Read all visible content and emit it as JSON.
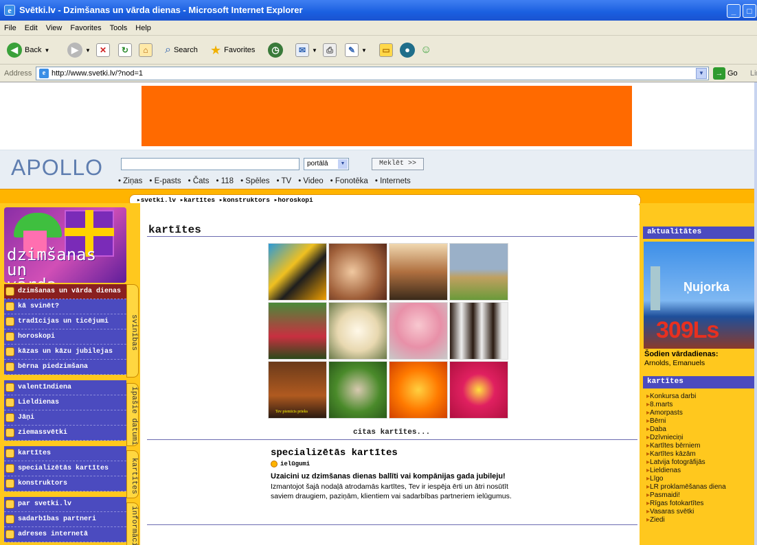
{
  "window": {
    "title": "Svētki.lv - Dzimšanas un vārda dienas - Microsoft Internet Explorer"
  },
  "menubar": [
    "File",
    "Edit",
    "View",
    "Favorites",
    "Tools",
    "Help"
  ],
  "toolbar": {
    "back": "Back",
    "search": "Search",
    "favorites": "Favorites"
  },
  "address": {
    "label": "Address",
    "url": "http://www.svetki.lv/?nod=1",
    "go": "Go",
    "links": "Lin"
  },
  "portal": {
    "logo": "APOLLO",
    "select": "portālā",
    "button": "Meklēt >>",
    "nav": [
      "Ziņas",
      "E-pasts",
      "Čats",
      "118",
      "Spēles",
      "TV",
      "Video",
      "Fonotēka",
      "Internets"
    ]
  },
  "breadcrumb": [
    "svetki.lv",
    "kartītes",
    "konstruktors",
    "horoskopi"
  ],
  "promo": {
    "line1": "dzimšanas un",
    "line2": "vārda dienas"
  },
  "sidemenu": {
    "group1": {
      "tab": "svinības",
      "items": [
        "dzimšanas un vārda dienas",
        "kā svinēt?",
        "tradīcijas un ticējumi",
        "horoskopi",
        "kāzas un kāzu jubilejas",
        "bērna piedzimšana"
      ]
    },
    "group2": {
      "tab": "īpašie datumi",
      "items": [
        "valentīndiena",
        "Lieldienas",
        "Jāņi",
        "ziemassvētki"
      ]
    },
    "group3": {
      "tab": "kartītes",
      "items": [
        "kartītes",
        "specializētās kartītes",
        "konstruktors"
      ]
    },
    "group4": {
      "tab": "informācija",
      "items": [
        "par svetki.lv",
        "sadarbības partneri",
        "adreses internetā"
      ]
    }
  },
  "main": {
    "heading": "kartītes",
    "more": "citas kartītes...",
    "special": {
      "title": "specializētās kartītes",
      "tag": "ielūgumi",
      "bold": "Uzaicini uz dzimšanas dienas ballīti vai kompānijas gada jubileju!",
      "text": "Izmantojot šajā nodaļā atrodamās kartītes, Tev ir iespēja ērti un ātri nosūtīt saviem draugiem, paziņām, klientiem vai sadarbības partneriem ielūgumus."
    },
    "thumb_caption": "Tev piemīcis prieks"
  },
  "right": {
    "news_head": "aktualitātes",
    "ad_city": "Ņujorka",
    "ad_price": "309Ls",
    "nameday_label": "Šodien vārdadienas:",
    "nameday_names": "Arnolds, Emanuels",
    "cards_head": "kartītes",
    "cards": [
      "Konkursa darbi",
      "8.marts",
      "Amorpasts",
      "Bērni",
      "Daba",
      "Dzīvnieciņi",
      "Kartītes bērniem",
      "Kartītes kāzām",
      "Latvija fotogrāfijās",
      "Lieldienas",
      "Līgo",
      "LR proklamēšanas diena",
      "Pasmaidi!",
      "Rīgas fotokartītes",
      "Vasaras svētki",
      "Ziedi"
    ]
  },
  "colors": {
    "accent": "#ff6a00",
    "sidebar": "#ffc81e",
    "menu": "#4b4bbf"
  }
}
